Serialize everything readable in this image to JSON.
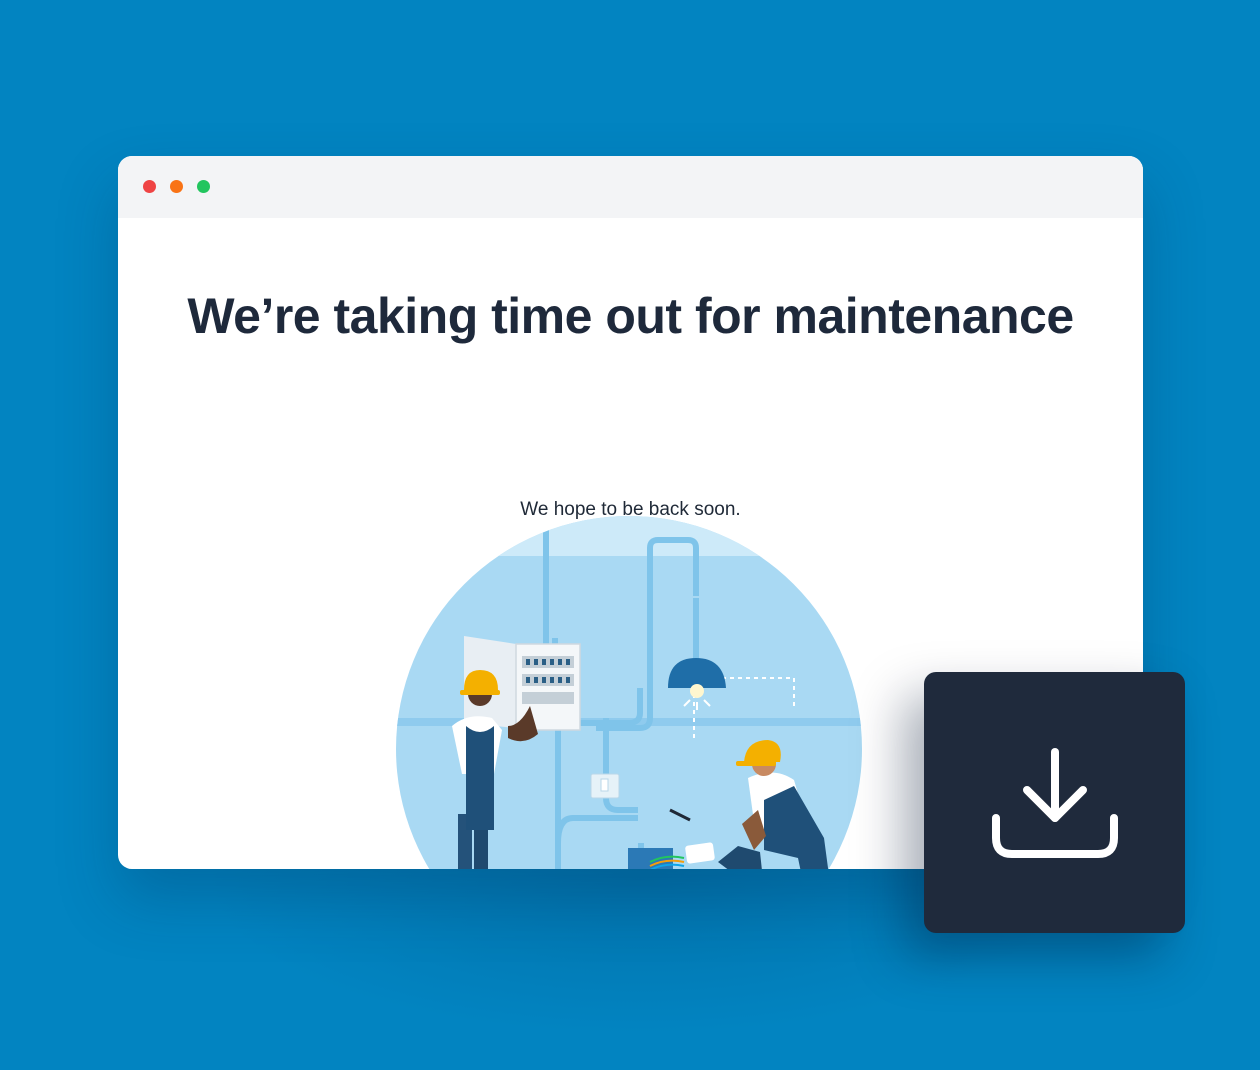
{
  "page": {
    "background_color": "#0284c1"
  },
  "browser_window": {
    "controls": [
      "close",
      "minimize",
      "maximize"
    ],
    "control_colors": [
      "#ef4444",
      "#f97316",
      "#22c55e"
    ]
  },
  "maintenance": {
    "headline": "We’re taking time out for maintenance",
    "subline": "We hope to be back soon.",
    "illustration": "two-electricians-working-icon"
  },
  "download_card": {
    "icon": "download-icon",
    "color": "#1f2a3c"
  }
}
